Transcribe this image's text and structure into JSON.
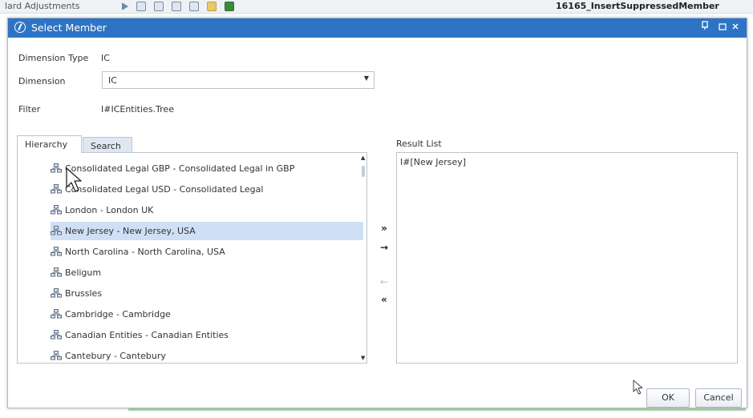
{
  "background": {
    "left_text": "lard Adjustments",
    "right_text": "16165_InsertSuppressedMember"
  },
  "dialog": {
    "title": "Select Member",
    "dimension_type_label": "Dimension Type",
    "dimension_type_value": "IC",
    "dimension_label": "Dimension",
    "dimension_value": "IC",
    "filter_label": "Filter",
    "filter_value": "I#ICEntities.Tree"
  },
  "tabs": [
    {
      "label": "Hierarchy",
      "active": true
    },
    {
      "label": "Search",
      "active": false
    }
  ],
  "tree": {
    "items": [
      {
        "label": "Consolidated Legal GBP - Consolidated Legal in GBP",
        "selected": false
      },
      {
        "label": "Consolidated Legal USD - Consolidated Legal",
        "selected": false
      },
      {
        "label": "London - London UK",
        "selected": false
      },
      {
        "label": "New Jersey - New Jersey, USA",
        "selected": true
      },
      {
        "label": "North Carolina - North Carolina, USA",
        "selected": false
      },
      {
        "label": "Beligum",
        "selected": false
      },
      {
        "label": "Brussles",
        "selected": false
      },
      {
        "label": "Cambridge - Cambridge",
        "selected": false
      },
      {
        "label": "Canadian Entities - Canadian Entities",
        "selected": false
      },
      {
        "label": "Cantebury - Cantebury",
        "selected": false
      }
    ]
  },
  "move_buttons": {
    "add_all": "»",
    "add": "→",
    "remove": "←",
    "remove_all": "«"
  },
  "result": {
    "label": "Result List",
    "items": [
      "I#[New Jersey]"
    ]
  },
  "buttons": {
    "ok": "OK",
    "cancel": "Cancel"
  },
  "colors": {
    "title_bar": "#2e74c5",
    "selection": "#cfe0f6"
  }
}
